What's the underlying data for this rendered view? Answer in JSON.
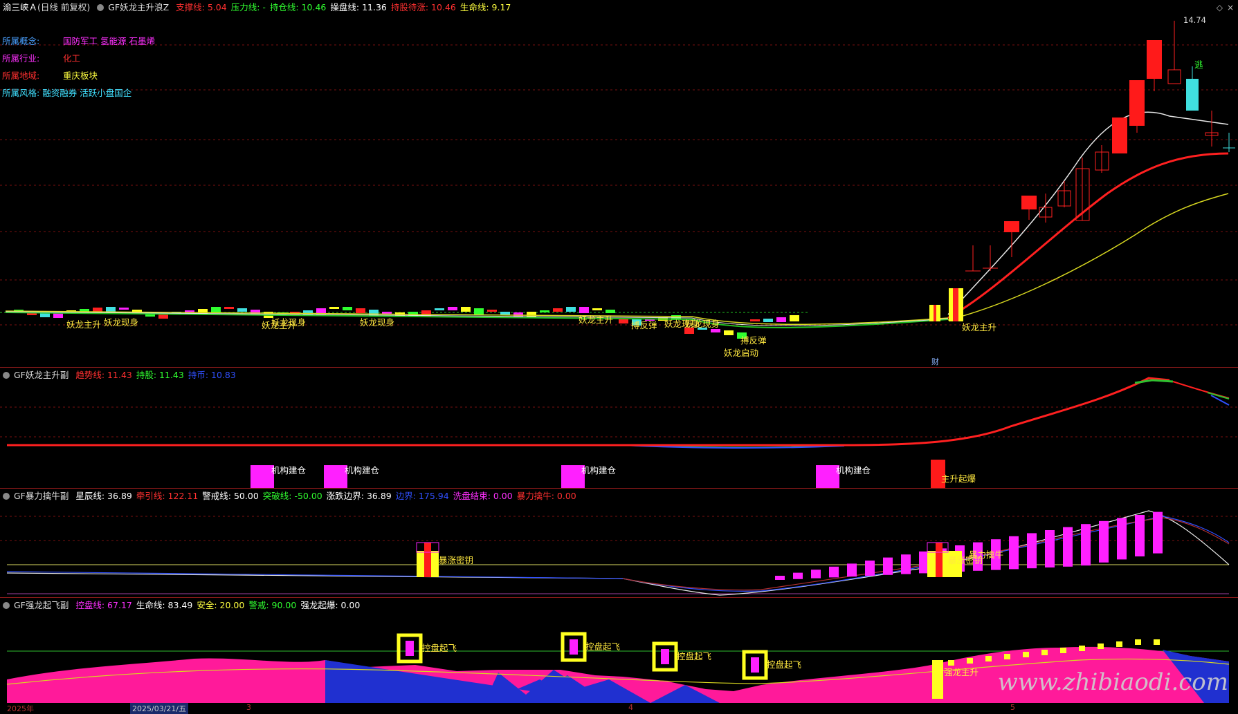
{
  "main": {
    "stock_name": "渝三峡Ａ",
    "mode": "(日线 前复权)",
    "indicator": "GF妖龙主升浪Z",
    "lines": [
      {
        "label": "支撑线:",
        "value": "5.04",
        "color": "#ff3030"
      },
      {
        "label": "压力线:",
        "value": "-",
        "color": "#30ff30"
      },
      {
        "label": "持仓线:",
        "value": "10.46",
        "color": "#30ff30"
      },
      {
        "label": "操盘线:",
        "value": "11.36",
        "color": "#ffffff"
      },
      {
        "label": "持股待涨:",
        "value": "10.46",
        "color": "#ff3030"
      },
      {
        "label": "生命线:",
        "value": "9.17",
        "color": "#ffff40"
      }
    ],
    "high_label": "14.74",
    "escape_label": "逃",
    "finance_label": "财"
  },
  "info": [
    {
      "key": "所属概念:",
      "value": "国防军工 氢能源 石墨烯",
      "key_color": "#4aa0ff",
      "val_color": "#ff30ff"
    },
    {
      "key": "所属行业:",
      "value": "化工",
      "key_color": "#ff30ff",
      "val_color": "#ff3030"
    },
    {
      "key": "所属地域:",
      "value": "重庆板块",
      "key_color": "#ff3030",
      "val_color": "#ffff40"
    },
    {
      "key": "所属风格:",
      "value": "融资融券 活跃小盘国企",
      "key_color": "#40e0ff",
      "val_color": "#40e0ff"
    }
  ],
  "main_signals": [
    "妖龙主升",
    "妖龙现身",
    "妖龙主升",
    "妖龙现身",
    "妖龙现身",
    "妖龙主升",
    "妖龙现身",
    "搏反弹",
    "妖龙现身",
    "搏反弹",
    "妖龙启动",
    "妖龙主升"
  ],
  "p2": {
    "indicator": "GF妖龙主升副",
    "lines": [
      {
        "label": "趋势线:",
        "value": "11.43",
        "color": "#ff3030"
      },
      {
        "label": "持股:",
        "value": "11.43",
        "color": "#30ff30"
      },
      {
        "label": "持币:",
        "value": "10.83",
        "color": "#3050ff"
      }
    ],
    "signals": [
      "机构建仓",
      "机构建仓",
      "机构建仓",
      "机构建仓",
      "主升起爆"
    ]
  },
  "p3": {
    "indicator": "GF暴力擒牛副",
    "lines": [
      {
        "label": "星辰线:",
        "value": "36.89",
        "color": "#ffffff"
      },
      {
        "label": "牵引线:",
        "value": "122.11",
        "color": "#ff3030"
      },
      {
        "label": "警戒线:",
        "value": "50.00",
        "color": "#ffffff"
      },
      {
        "label": "突破线:",
        "value": "-50.00",
        "color": "#30ff30"
      },
      {
        "label": "涨跌边界:",
        "value": "36.89",
        "color": "#ffffff"
      },
      {
        "label": "边界:",
        "value": "175.94",
        "color": "#3050ff"
      },
      {
        "label": "洗盘结束:",
        "value": "0.00",
        "color": "#ff30ff"
      },
      {
        "label": "暴力擒牛:",
        "value": "0.00",
        "color": "#ff3030"
      }
    ],
    "signals": [
      "暴涨密钥",
      "暴涨密钥",
      "暴力擒牛"
    ]
  },
  "p4": {
    "indicator": "GF强龙起飞副",
    "lines": [
      {
        "label": "控盘线:",
        "value": "67.17",
        "color": "#ff30ff"
      },
      {
        "label": "生命线:",
        "value": "83.49",
        "color": "#ffffff"
      },
      {
        "label": "安全:",
        "value": "20.00",
        "color": "#ffff40"
      },
      {
        "label": "警戒:",
        "value": "90.00",
        "color": "#30ff30"
      },
      {
        "label": "强龙起爆:",
        "value": "0.00",
        "color": "#ffffff"
      }
    ],
    "signals": [
      "控盘起飞",
      "控盘起飞",
      "控盘起飞",
      "控盘起飞",
      "强龙主升"
    ]
  },
  "axis": {
    "year": "2025年",
    "date": "2025/03/21/五",
    "m1": "3",
    "m2": "4",
    "m3": "5"
  },
  "watermark": "www.zhibiaodi.com"
}
